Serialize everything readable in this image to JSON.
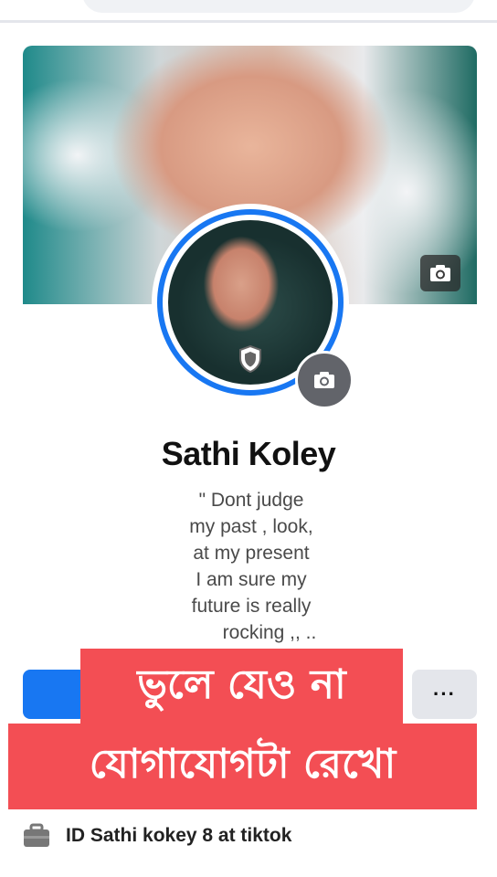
{
  "profile": {
    "name": "Sathi Koley",
    "bio_lines": [
      "\" Dont  judge",
      "my  past , look,",
      "at my present",
      "I am sure my",
      "future is really",
      "rocking ,, .."
    ],
    "work_text": "ID Sathi kokey 8 at tiktok"
  },
  "actions": {
    "more_label": "···"
  },
  "overlay": {
    "line1": "ভুলে যেও না",
    "line2": "যোগাযোগটা রেখো"
  },
  "icons": {
    "cover_camera": "camera-icon",
    "avatar_camera": "camera-icon",
    "avatar_guard": "shield-icon",
    "work": "briefcase-icon"
  },
  "colors": {
    "accent": "#1877f2",
    "overlay_red": "#f34e54"
  }
}
